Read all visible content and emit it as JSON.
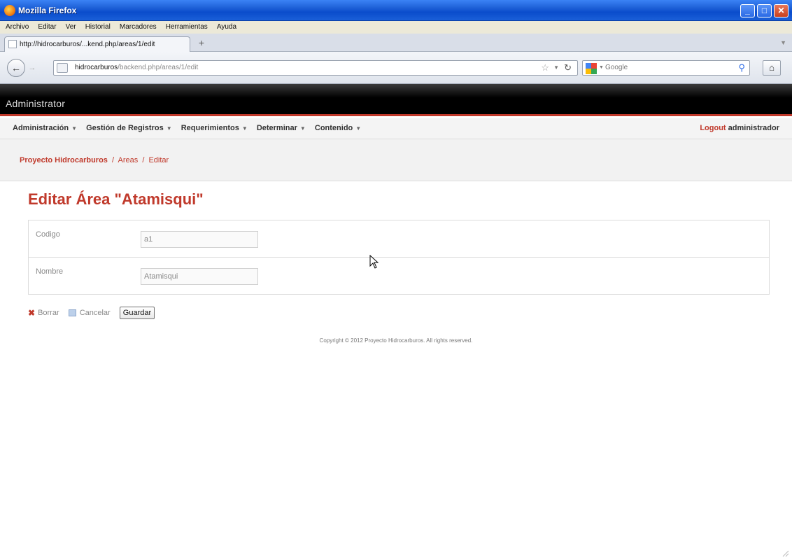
{
  "window": {
    "title": "Mozilla Firefox"
  },
  "menubar": [
    "Archivo",
    "Editar",
    "Ver",
    "Historial",
    "Marcadores",
    "Herramientas",
    "Ayuda"
  ],
  "tab": {
    "label": "http://hidrocarburos/...kend.php/areas/1/edit",
    "new_tab": "+"
  },
  "navbar": {
    "url_host": "hidrocarburos",
    "url_path": "/backend.php/areas/1/edit",
    "search_placeholder": "Google"
  },
  "app": {
    "brand": "Administrator"
  },
  "mainmenu": {
    "items": [
      "Administración",
      "Gestión de Registros",
      "Requerimientos",
      "Determinar",
      "Contenido"
    ],
    "logout": "Logout",
    "user": "administrador"
  },
  "breadcrumb": {
    "root": "Proyecto Hidrocarburos",
    "sep": "/",
    "section": "Areas",
    "current": "Editar"
  },
  "page": {
    "title": "Editar Área \"Atamisqui\""
  },
  "form": {
    "codigo_label": "Codigo",
    "codigo_value": "a1",
    "nombre_label": "Nombre",
    "nombre_value": "Atamisqui"
  },
  "actions": {
    "delete": "Borrar",
    "cancel": "Cancelar",
    "save": "Guardar"
  },
  "footer": {
    "copyright": "Copyright © 2012 Proyecto Hidrocarburos. All rights reserved."
  },
  "colors": {
    "accent": "#c0392b",
    "titlebar": "#0a4ccc",
    "header": "#000000"
  }
}
